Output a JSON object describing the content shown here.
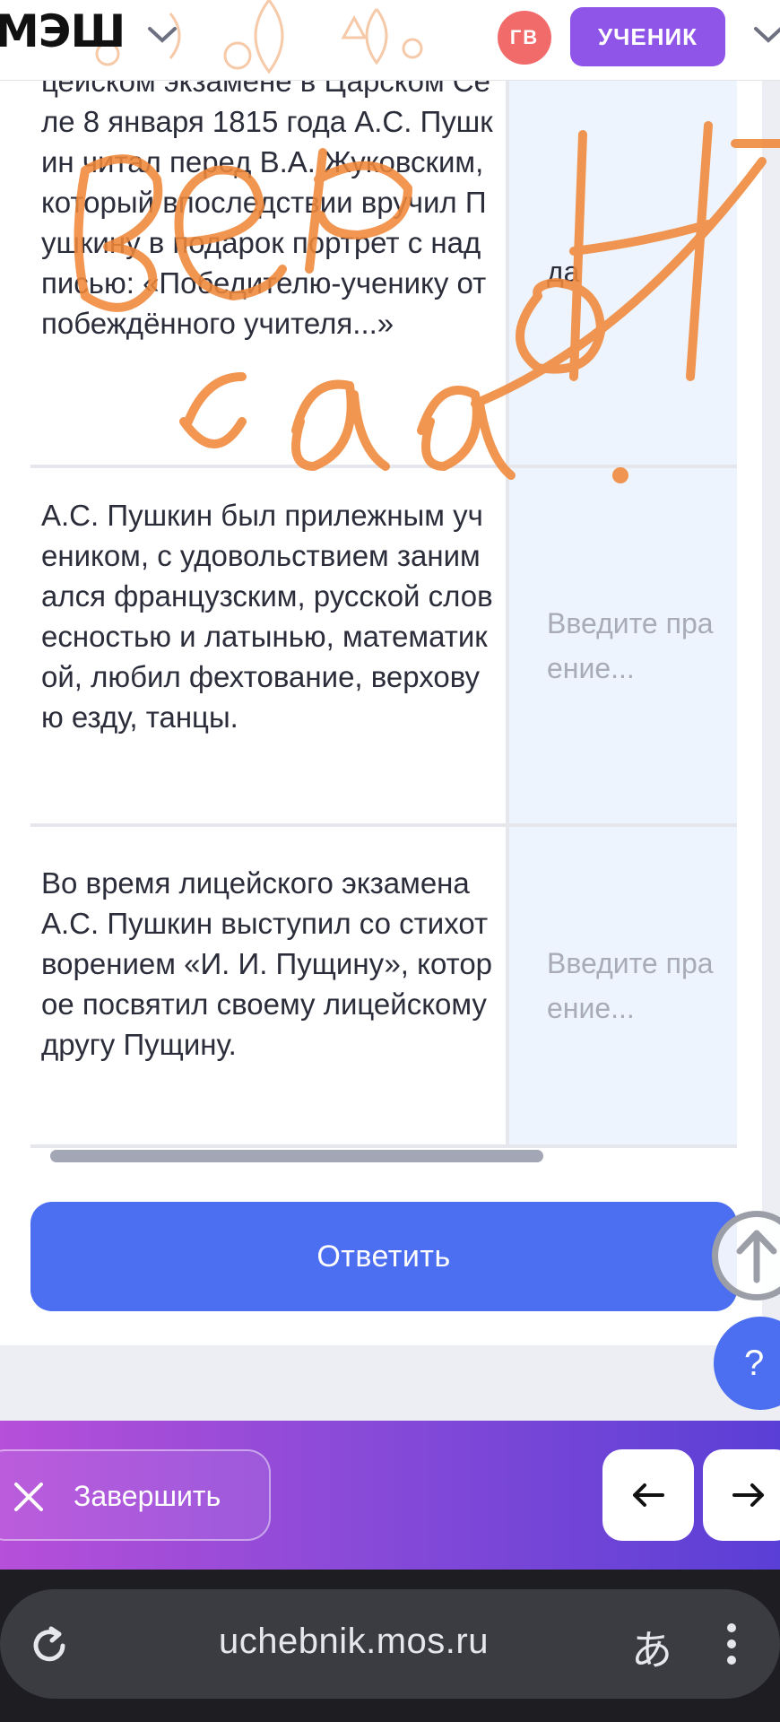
{
  "header": {
    "logo": "МЭШ",
    "avatar_initials": "ГВ",
    "role_badge": "УЧЕНИК"
  },
  "table": {
    "rows": [
      {
        "statement": "цейском экзамене в Царском Селе 8 января 1815 года А.С. Пушкин читал перед В.А. Жуковским, который впоследствии вручил Пушкину в подарок портрет с надписью: «Победителю-ученику от побеждённого учителя...»",
        "answer": "да",
        "answer_placeholder": ""
      },
      {
        "statement": "А.С. Пушкин был прилежным учеником, с удовольствием занимался французским, русской словесностью и латынью, математикой, любил фехтование, верховую езду, танцы.",
        "answer": "",
        "answer_placeholder": "Введите пра\nение..."
      },
      {
        "statement": "Во время лицейского экзамена А.С. Пушкин выступил со стихотворением «И. И. Пущину», которое посвятил своему лицейскому другу Пущину.",
        "answer": "",
        "answer_placeholder": "Введите пра\nение..."
      }
    ]
  },
  "actions": {
    "submit_label": "Ответить",
    "help_label": "?"
  },
  "footer_nav": {
    "finish_label": "Завершить"
  },
  "browser": {
    "url": "uchebnik.mos.ru",
    "translate_glyph": "あ"
  },
  "colors": {
    "accent_blue": "#4c6ef0",
    "role_purple": "#8f55e8",
    "avatar_red": "#f26b6b",
    "handwriting_orange": "#f0883a"
  }
}
